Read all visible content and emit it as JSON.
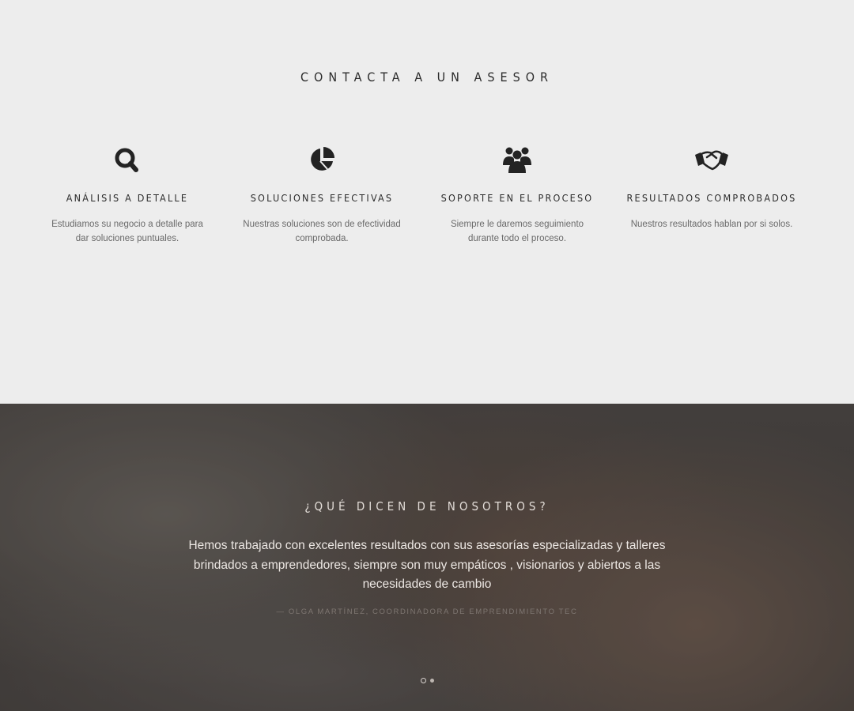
{
  "contact_section": {
    "title": "CONTACTA A UN ASESOR",
    "features": [
      {
        "icon": "magnifier-icon",
        "title": "ANÁLISIS A DETALLE",
        "description": "Estudiamos su negocio a detalle para dar soluciones puntuales."
      },
      {
        "icon": "pie-chart-icon",
        "title": "SOLUCIONES EFECTIVAS",
        "description": "Nuestras soluciones son de efectividad comprobada."
      },
      {
        "icon": "users-icon",
        "title": "SOPORTE EN EL PROCESO",
        "description": "Siempre le daremos seguimiento durante todo el proceso."
      },
      {
        "icon": "handshake-icon",
        "title": "RESULTADOS COMPROBADOS",
        "description": "Nuestros resultados hablan por si solos."
      }
    ]
  },
  "testimonials": {
    "title": "¿QUÉ DICEN DE NOSOTROS?",
    "quote": "Hemos trabajado con excelentes resultados con sus asesorías especializadas y talleres brindados a emprendedores, siempre son muy empáticos , visionarios y abiertos a las necesidades de cambio",
    "author": "—  OLGA MARTÍNEZ, COORDINADORA DE EMPRENDIMIENTO TEC",
    "slides_total": 2,
    "active_slide": 1
  }
}
